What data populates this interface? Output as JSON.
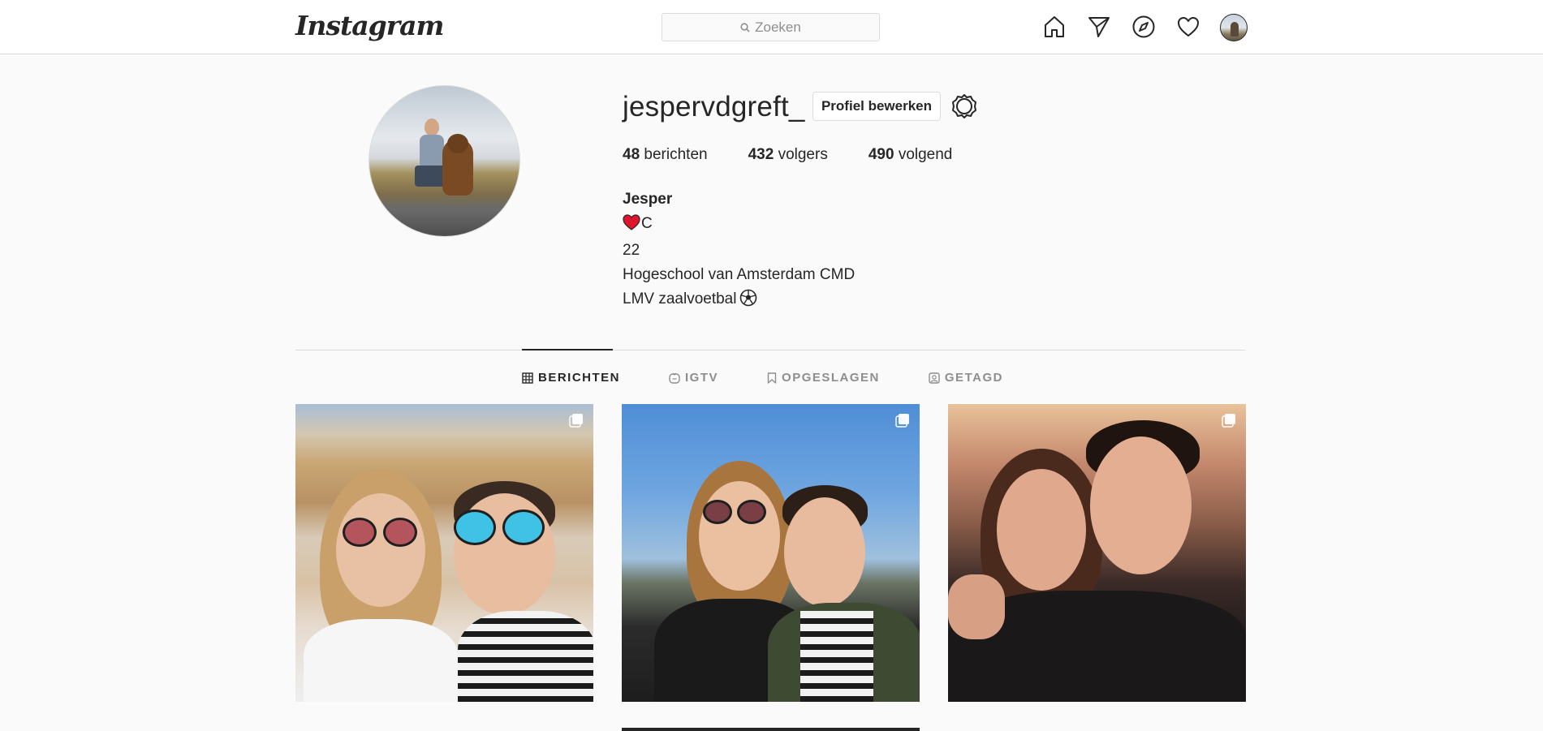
{
  "header": {
    "logo_text": "Instagram",
    "search_placeholder": "Zoeken",
    "nav_icons": [
      "home-icon",
      "direct-icon",
      "explore-icon",
      "activity-heart-icon",
      "profile-avatar"
    ]
  },
  "profile": {
    "username": "jespervdgreft_",
    "edit_button_label": "Profiel bewerken",
    "stats": [
      {
        "count": "48",
        "label": "berichten"
      },
      {
        "count": "432",
        "label": "volgers"
      },
      {
        "count": "490",
        "label": "volgend"
      }
    ],
    "bio": {
      "name": "Jesper",
      "line1": "C",
      "line2": "22",
      "line3": "Hogeschool van Amsterdam CMD",
      "line4": "LMV zaalvoetbal"
    }
  },
  "tabs": [
    {
      "label": "BERICHTEN",
      "icon": "grid-icon",
      "active": true
    },
    {
      "label": "IGTV",
      "icon": "igtv-icon",
      "active": false
    },
    {
      "label": "OPGESLAGEN",
      "icon": "bookmark-icon",
      "active": false
    },
    {
      "label": "GETAGD",
      "icon": "tagged-icon",
      "active": false
    }
  ],
  "posts": [
    {
      "multiple": true
    },
    {
      "multiple": true
    },
    {
      "multiple": true
    }
  ],
  "colors": {
    "text": "#262626",
    "muted": "#8e8e8e",
    "border": "#dbdbdb",
    "background": "#fafafa"
  }
}
